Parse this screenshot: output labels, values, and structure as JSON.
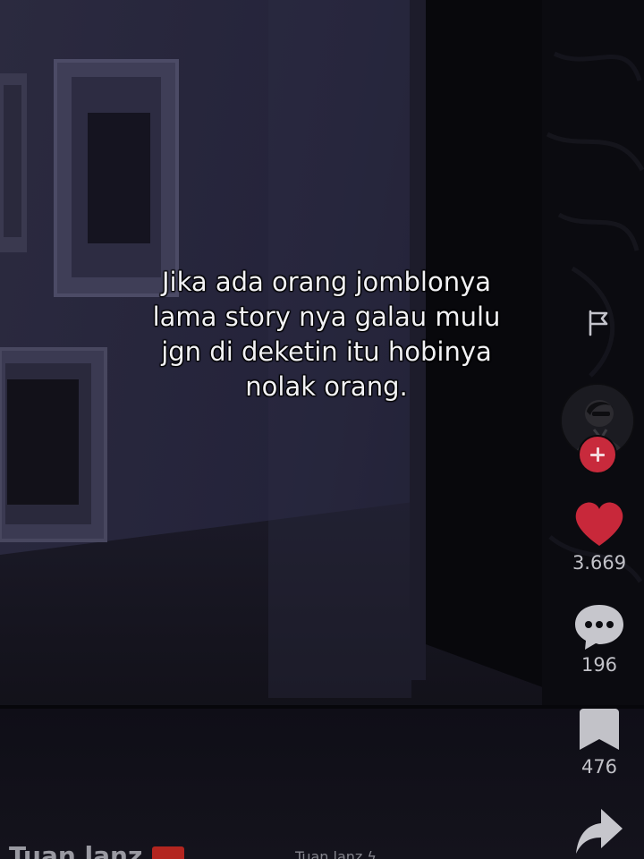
{
  "video": {
    "caption_lines": [
      "Jika ada orang jomblonya",
      "lama story nya galau mulu",
      "jgn di deketin itu hobinya",
      "nolak orang."
    ]
  },
  "sidebar": {
    "report_icon": "flag-icon",
    "creator_avatar": "avatar",
    "follow_icon": "plus-icon",
    "likes": {
      "icon": "heart-icon",
      "count": "3.669",
      "color": "#c8283a"
    },
    "comments": {
      "icon": "comment-icon",
      "count": "196"
    },
    "saves": {
      "icon": "bookmark-icon",
      "count": "476"
    },
    "share": {
      "icon": "share-icon"
    }
  },
  "footer": {
    "username": "Tuan lanz",
    "sound_label": "Tuan lanz ϟ"
  }
}
